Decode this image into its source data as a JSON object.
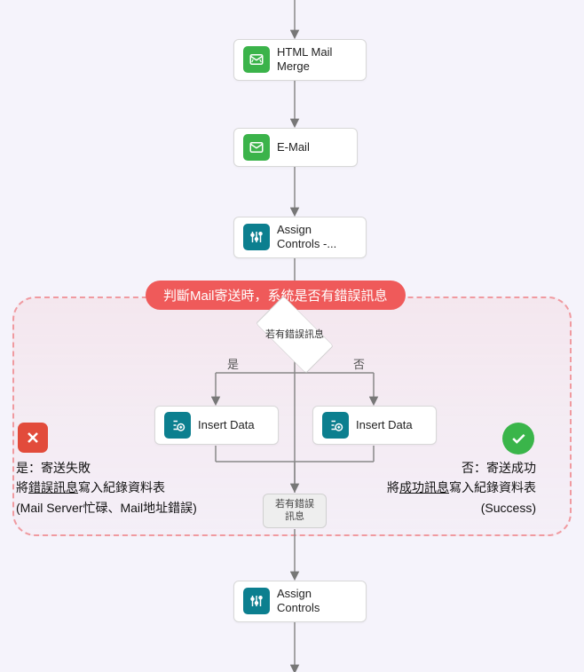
{
  "nodes": {
    "htmlMailMerge": {
      "label": "HTML Mail Merge",
      "icon": "mail-merge-icon"
    },
    "email": {
      "label": "E-Mail",
      "icon": "envelope-icon"
    },
    "assignControlsTop": {
      "label": "Assign Controls -...",
      "icon": "sliders-icon"
    },
    "insertDataLeft": {
      "label": "Insert Data",
      "icon": "insert-icon"
    },
    "insertDataRight": {
      "label": "Insert Data",
      "icon": "insert-icon"
    },
    "assignControlsBottom": {
      "label": "Assign Controls",
      "icon": "sliders-icon"
    }
  },
  "decision": {
    "top": "若有錯誤訊息",
    "merge": "若有錯誤訊息"
  },
  "branchLabels": {
    "yes": "是",
    "no": "否"
  },
  "callout": "判斷Mail寄送時，系統是否有錯誤訊息",
  "annotLeft": {
    "line1": "是：寄送失敗",
    "line2a": "將",
    "line2b": "錯誤訊息",
    "line2c": "寫入紀錄資料表",
    "line3": "(Mail Server忙碌、Mail地址錯誤)"
  },
  "annotRight": {
    "line1": "否：寄送成功",
    "line2a": "將",
    "line2b": "成功訊息",
    "line2c": "寫入紀錄資料表",
    "line3": "(Success)"
  }
}
